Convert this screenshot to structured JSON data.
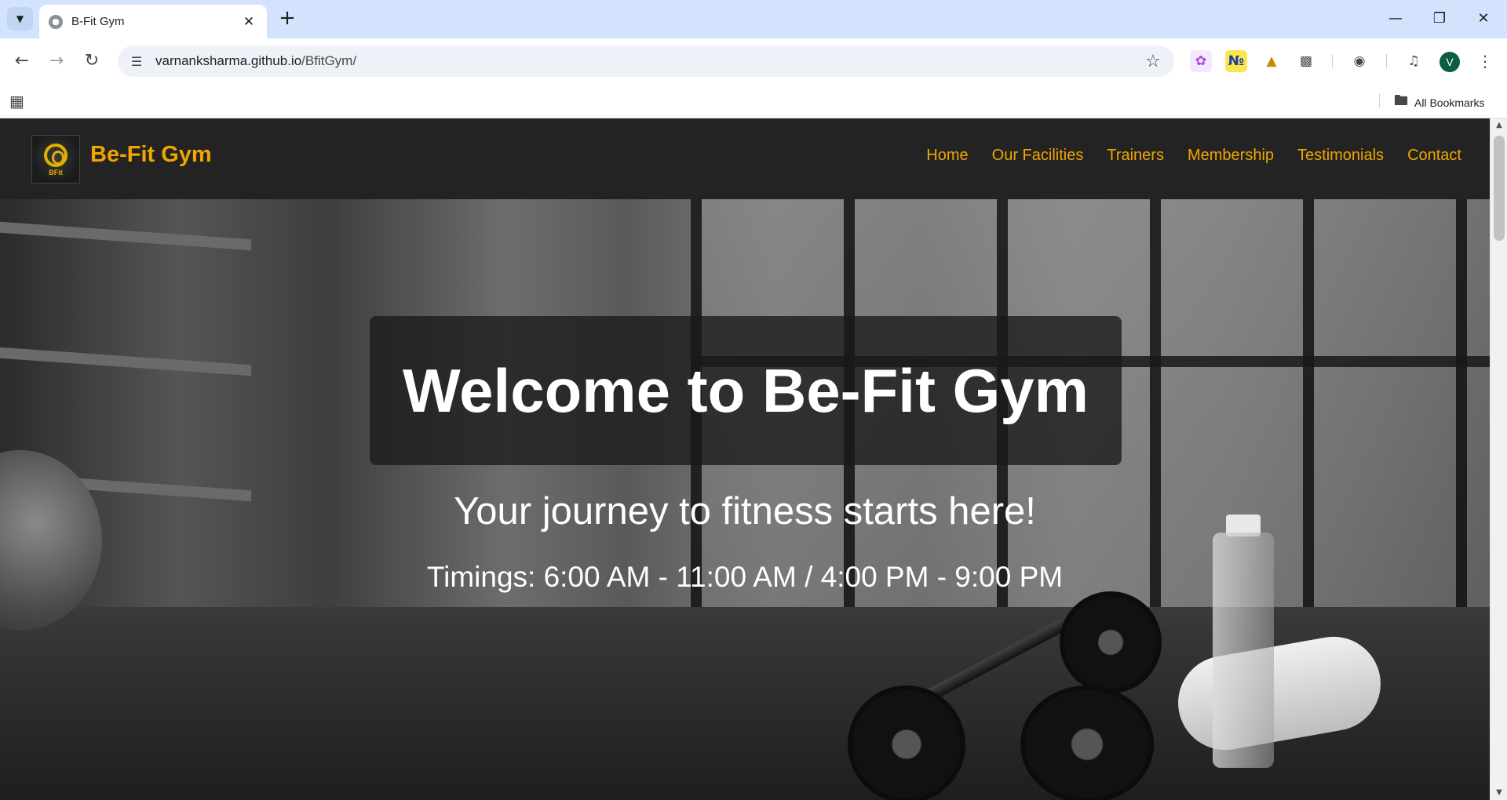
{
  "browser": {
    "tab_title": "B-Fit Gym",
    "url_host": "varnanksharma.github.io",
    "url_path": "/BfitGym/",
    "avatar_initial": "V",
    "bookmarks_label": "All Bookmarks"
  },
  "site": {
    "brand": "Be-Fit Gym",
    "logo_text": "BFit",
    "accent_color": "#f0a500",
    "nav": [
      {
        "label": "Home"
      },
      {
        "label": "Our Facilities"
      },
      {
        "label": "Trainers"
      },
      {
        "label": "Membership"
      },
      {
        "label": "Testimonials"
      },
      {
        "label": "Contact"
      }
    ]
  },
  "hero": {
    "title": "Welcome to Be-Fit Gym",
    "tagline": "Your journey to fitness starts here!",
    "timings": "Timings: 6:00 AM - 11:00 AM / 4:00 PM - 9:00 PM"
  }
}
